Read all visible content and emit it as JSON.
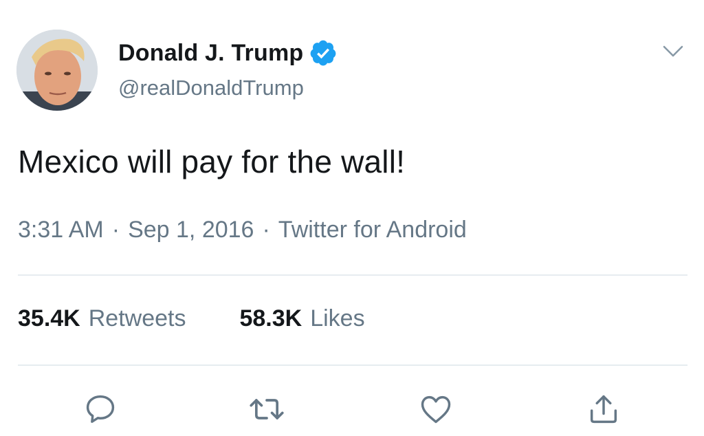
{
  "tweet": {
    "author": {
      "display_name": "Donald J. Trump",
      "handle": "@realDonaldTrump",
      "verified": true
    },
    "text": "Mexico will pay for the wall!",
    "meta": {
      "time": "3:31 AM",
      "separator": "·",
      "date": "Sep 1, 2016",
      "source": "Twitter for Android"
    },
    "stats": {
      "retweets_count": "35.4K",
      "retweets_label": "Retweets",
      "likes_count": "58.3K",
      "likes_label": "Likes"
    }
  },
  "icons": {
    "menu": "chevron-down-icon",
    "verified": "verified-badge-icon",
    "reply": "reply-icon",
    "retweet": "retweet-icon",
    "like": "heart-icon",
    "share": "share-icon"
  },
  "colors": {
    "text_primary": "#14171a",
    "text_secondary": "#657786",
    "verified_blue": "#1da1f2",
    "divider": "#e6ecf0"
  }
}
